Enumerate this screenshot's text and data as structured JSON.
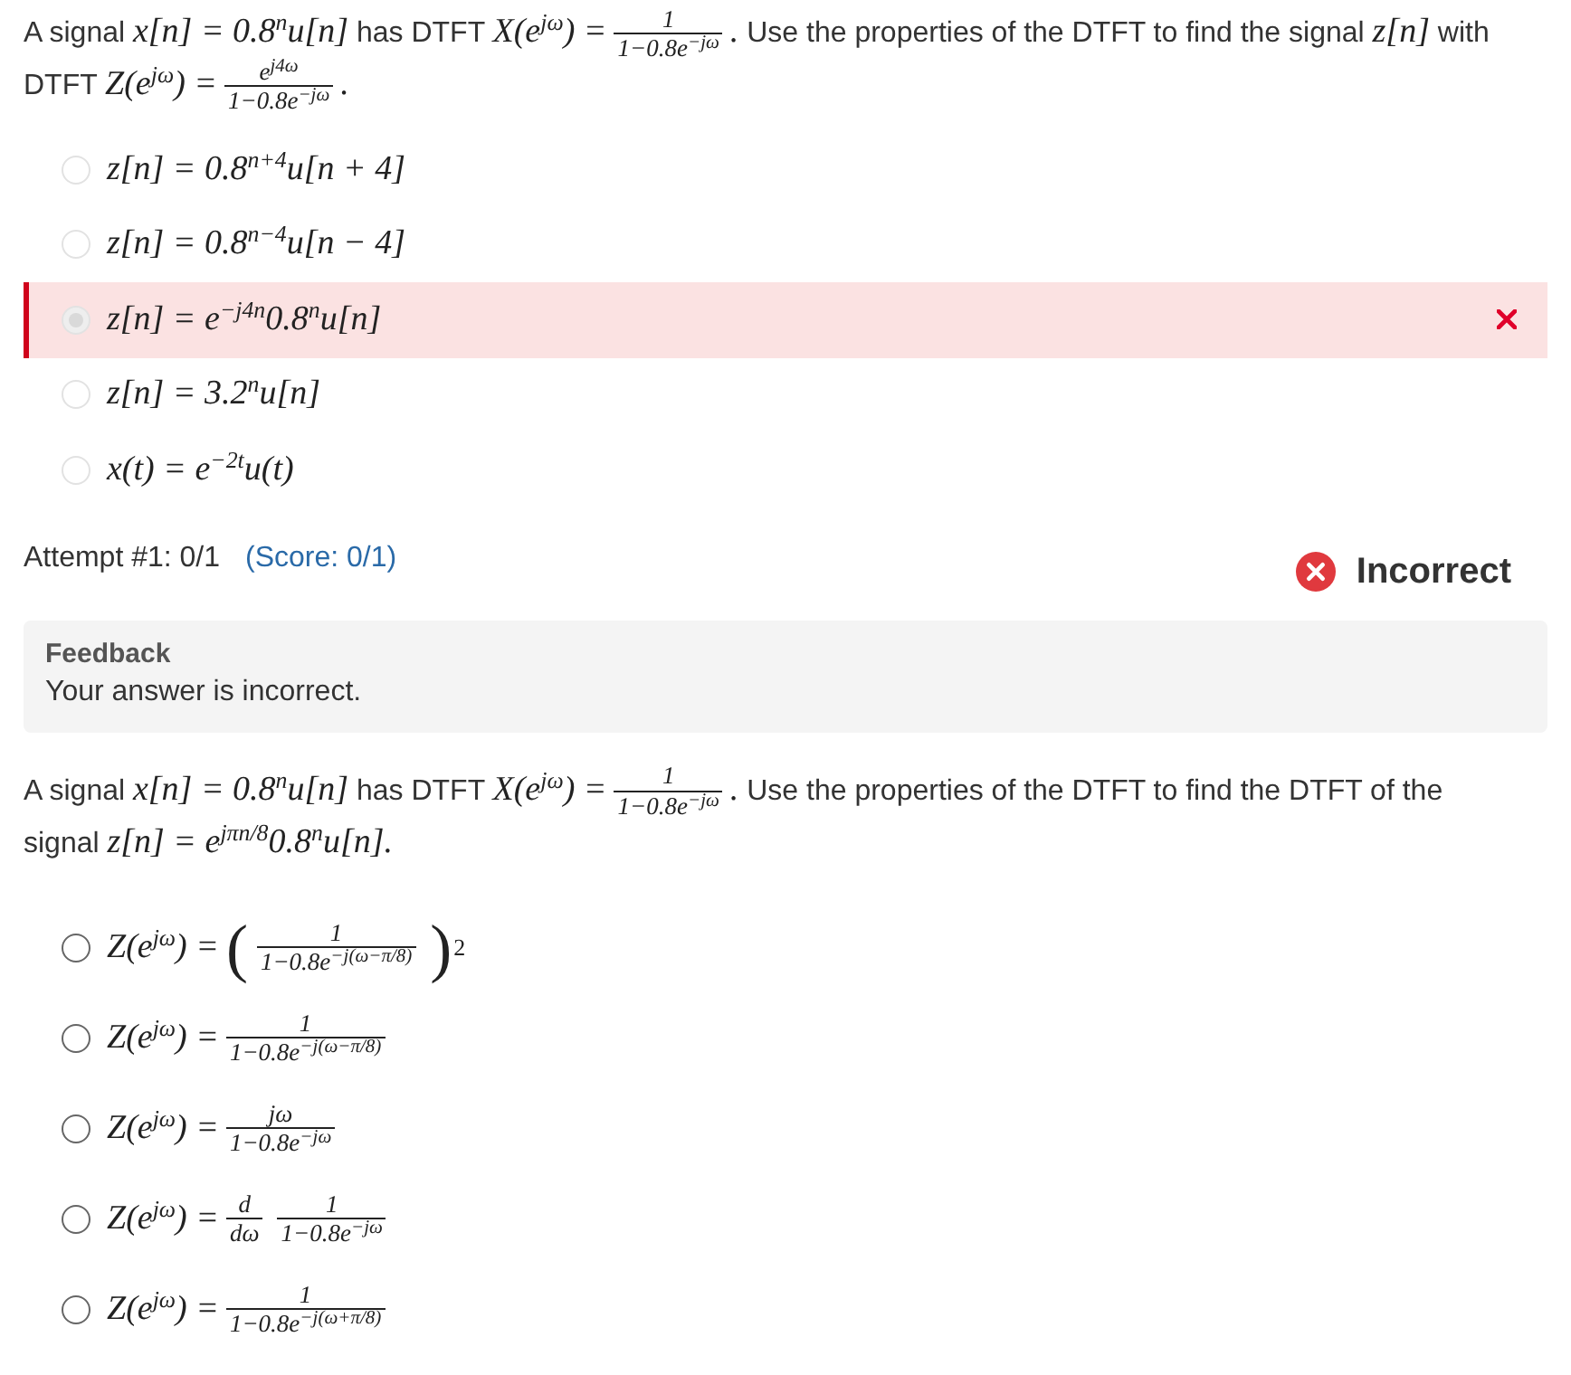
{
  "questions": [
    {
      "text": [
        {
          "kind": "text",
          "text": "A signal "
        },
        {
          "kind": "math",
          "text": "x[n] = 0.8$^{n}$u[n]"
        },
        {
          "kind": "text",
          "text": " has DTFT "
        },
        {
          "kind": "math",
          "text": "X(e$^{jω}$) ="
        },
        {
          "kind": "fraction",
          "numerator": "1",
          "denominator": "1−0.8e$^{−jω}$"
        },
        {
          "kind": "math",
          "text": "."
        },
        {
          "kind": "text",
          "text": " Use the properties of the DTFT to find the signal "
        },
        {
          "kind": "math",
          "text": "z[n]"
        },
        {
          "kind": "text",
          "text": " with DTFT "
        },
        {
          "kind": "math",
          "text": "Z(e$^{jω}$) ="
        },
        {
          "kind": "fraction",
          "numerator": "e$^{j4ω}$",
          "denominator": "1−0.8e$^{−jω}$"
        },
        {
          "kind": "math",
          "text": "."
        }
      ],
      "disabled": true,
      "options": [
        {
          "selected": false,
          "label": [
            {
              "kind": "math",
              "text": "z[n] = 0.8$^{n+4}$u[n + 4]"
            }
          ]
        },
        {
          "selected": false,
          "label": [
            {
              "kind": "math",
              "text": "z[n] = 0.8$^{n−4}$u[n − 4]"
            }
          ]
        },
        {
          "selected": true,
          "label": [
            {
              "kind": "math",
              "text": "z[n] = e$^{−j4n}$0.8$^{n}$u[n]"
            }
          ]
        },
        {
          "selected": false,
          "label": [
            {
              "kind": "math",
              "text": "z[n] = 3.2$^{n}$u[n]"
            }
          ]
        },
        {
          "selected": false,
          "label": [
            {
              "kind": "math",
              "text": "x(t) = e$^{−2t}$u(t)"
            }
          ]
        }
      ],
      "attempt": {
        "label": "Attempt #1: 0/1",
        "score": "(Score: 0/1)"
      },
      "status": {
        "kind": "incorrect",
        "label": "Incorrect"
      },
      "feedback": {
        "title": "Feedback",
        "text": "Your answer is incorrect."
      }
    },
    {
      "text": [
        {
          "kind": "text",
          "text": "A signal "
        },
        {
          "kind": "math",
          "text": "x[n] = 0.8$^{n}$u[n]"
        },
        {
          "kind": "text",
          "text": " has DTFT "
        },
        {
          "kind": "math",
          "text": "X(e$^{jω}$) ="
        },
        {
          "kind": "fraction",
          "numerator": "1",
          "denominator": "1−0.8e$^{−jω}$"
        },
        {
          "kind": "math",
          "text": "."
        },
        {
          "kind": "text",
          "text": " Use the properties of the DTFT to find the DTFT of the signal "
        },
        {
          "kind": "math",
          "text": "z[n] = e$^{jπn/8}$0.8$^{n}$u[n]."
        }
      ],
      "disabled": false,
      "options": [
        {
          "selected": false,
          "label": [
            {
              "kind": "math",
              "text": "Z(e$^{jω}$) ="
            },
            {
              "kind": "power_fraction",
              "open": "(",
              "numerator": "1",
              "denominator": "1−0.8e$^{−j(ω−π/8)}$",
              "close": ")",
              "exponent": "2"
            }
          ]
        },
        {
          "selected": false,
          "label": [
            {
              "kind": "math",
              "text": "Z(e$^{jω}$) ="
            },
            {
              "kind": "fraction",
              "numerator": "1",
              "denominator": "1−0.8e$^{−j(ω−π/8)}$"
            }
          ]
        },
        {
          "selected": false,
          "label": [
            {
              "kind": "math",
              "text": "Z(e$^{jω}$) ="
            },
            {
              "kind": "fraction",
              "numerator": "jω",
              "denominator": "1−0.8e$^{−jω}$"
            }
          ]
        },
        {
          "selected": false,
          "label": [
            {
              "kind": "math",
              "text": "Z(e$^{jω}$) ="
            },
            {
              "kind": "fraction",
              "numerator": "d",
              "denominator": "dω"
            },
            {
              "kind": "fraction",
              "numerator": "1",
              "denominator": "1−0.8e$^{−jω}$"
            }
          ]
        },
        {
          "selected": false,
          "label": [
            {
              "kind": "math",
              "text": "Z(e$^{jω}$) ="
            },
            {
              "kind": "fraction",
              "numerator": "1",
              "denominator": "1−0.8e$^{−j(ω+π/8)}$"
            }
          ]
        }
      ]
    }
  ]
}
